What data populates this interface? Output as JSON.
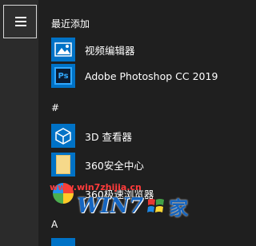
{
  "menu": {
    "icon": "hamburger-menu-icon"
  },
  "recent": {
    "header": "最近添加",
    "items": [
      {
        "label": "视频编辑器",
        "icon": "video-editor-icon",
        "tile_color": "#0072c6"
      },
      {
        "label": "Adobe Photoshop CC 2019",
        "icon": "photoshop-icon",
        "tile_color": "#0072c6",
        "badge": "Ps"
      }
    ]
  },
  "hash_group": {
    "header": "#",
    "items": [
      {
        "label": "3D 查看器",
        "icon": "3d-viewer-icon",
        "tile_color": "#0072c6"
      },
      {
        "label": "360安全中心",
        "icon": "folder-icon",
        "tile_color": "#0072c6"
      },
      {
        "label": "360极速浏览器",
        "icon": "360-browser-icon",
        "tile_color": "#0072c6"
      }
    ]
  },
  "a_group": {
    "header": "A"
  },
  "watermark": {
    "url": "www.win7zhijia.cn",
    "brand": "WIN7",
    "suffix": "家"
  }
}
